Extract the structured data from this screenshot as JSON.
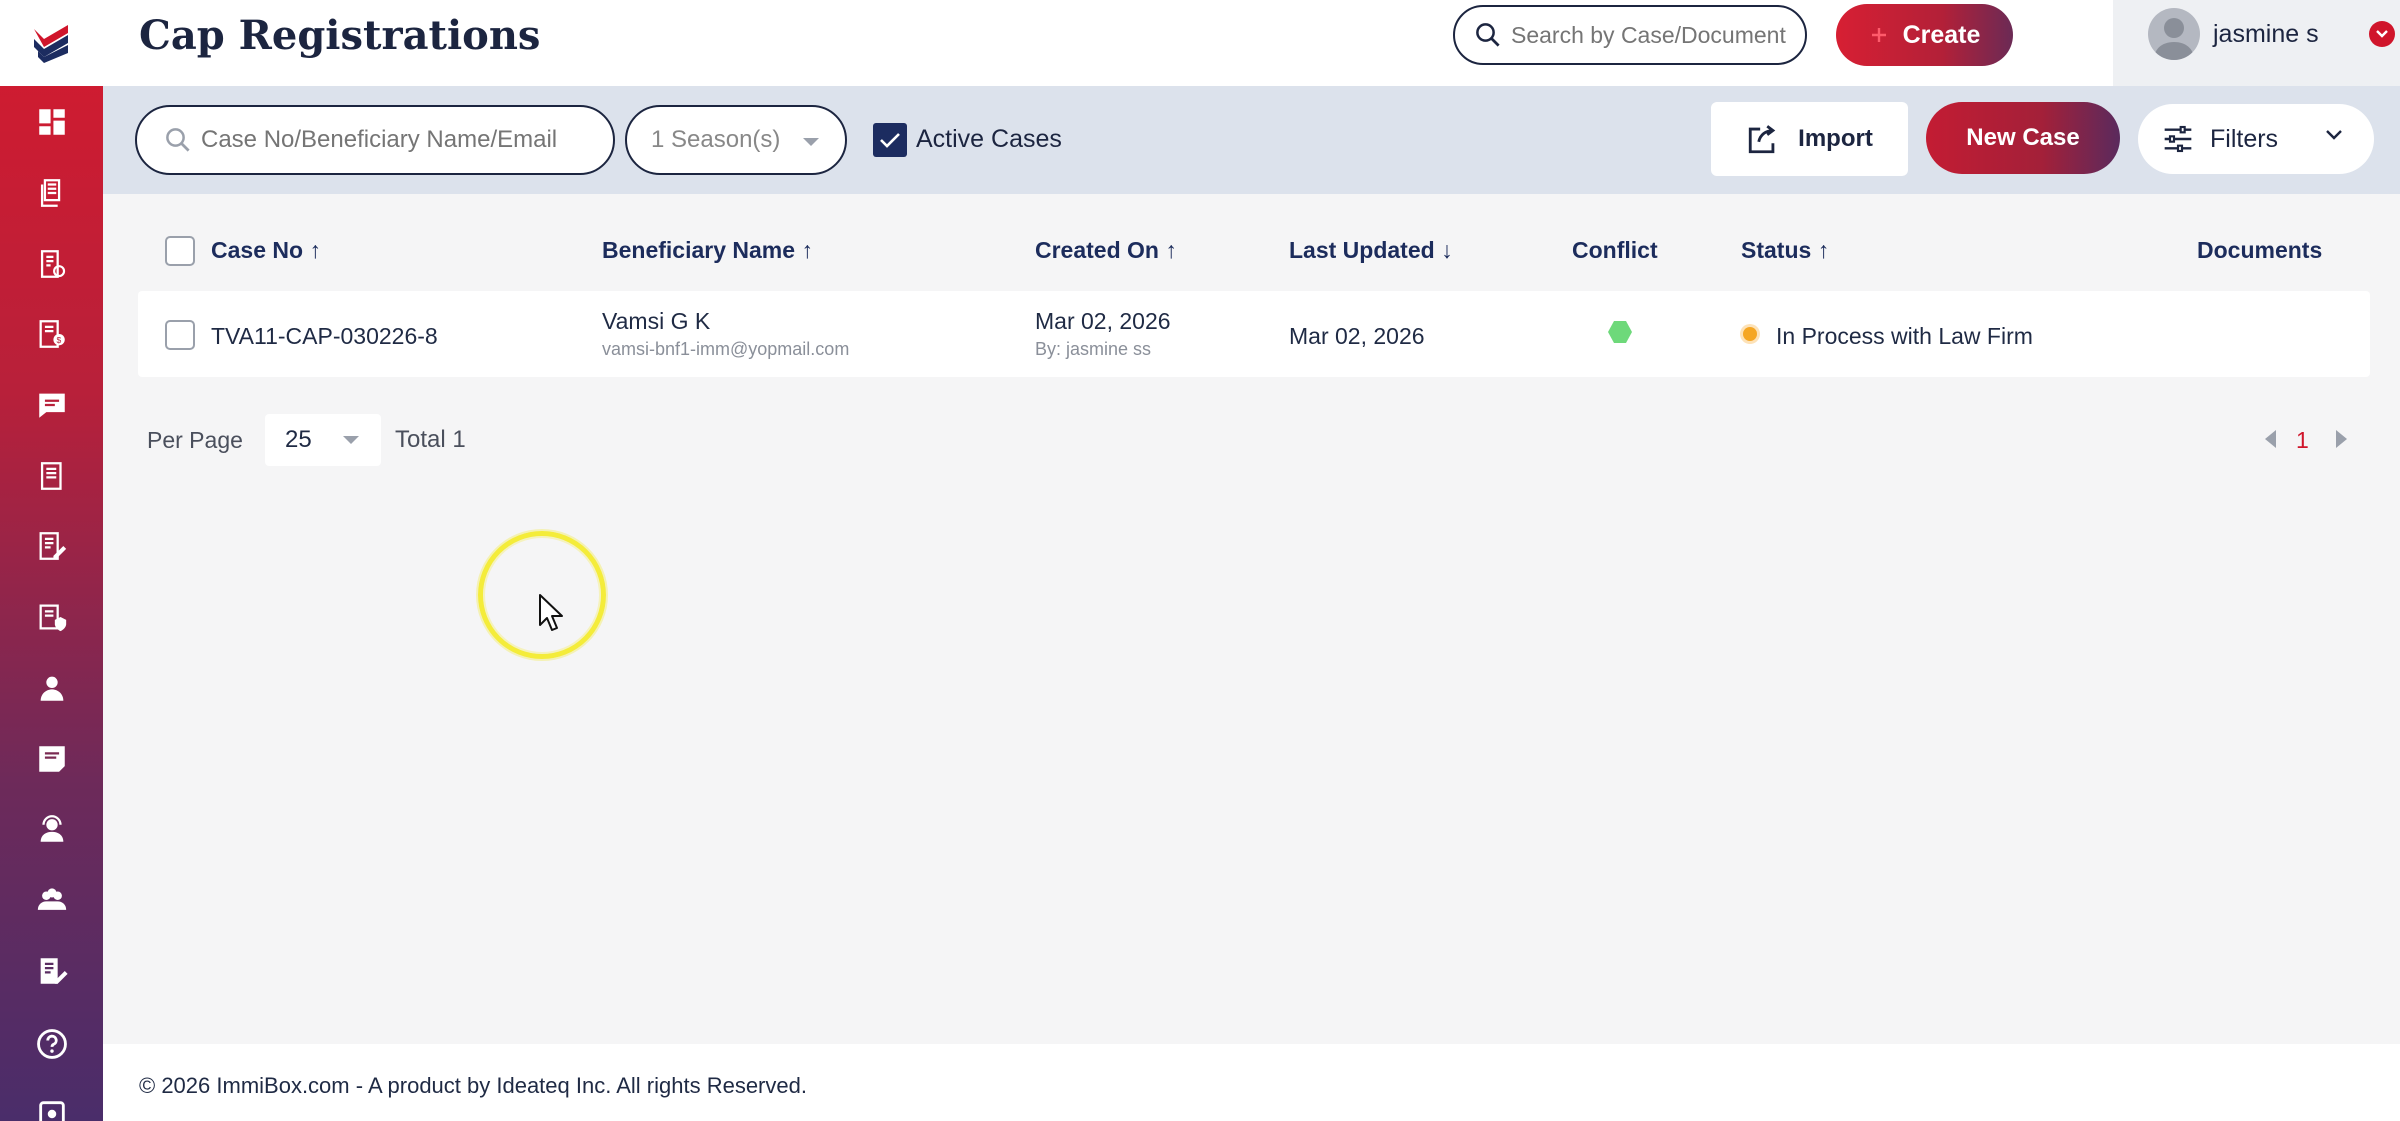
{
  "app": {
    "page_title": "Cap Registrations"
  },
  "sidebar": {
    "items": [
      {
        "icon": "dashboard-icon"
      },
      {
        "icon": "documents-icon"
      },
      {
        "icon": "forms-icon"
      },
      {
        "icon": "invoices-icon"
      },
      {
        "icon": "messages-icon"
      },
      {
        "icon": "book-icon"
      },
      {
        "icon": "edit-list-icon"
      },
      {
        "icon": "reports-icon"
      },
      {
        "icon": "person-icon"
      },
      {
        "icon": "notes-icon"
      },
      {
        "icon": "support-agent-icon"
      },
      {
        "icon": "team-icon"
      },
      {
        "icon": "document-edit-icon"
      },
      {
        "icon": "help-icon"
      },
      {
        "icon": "settings-icon"
      }
    ]
  },
  "header": {
    "search_placeholder": "Search by Case/Document",
    "create_label": "Create",
    "user_name": "jasmine s"
  },
  "toolbar": {
    "case_search_placeholder": "Case No/Beneficiary Name/Email",
    "season_value": "1 Season(s)",
    "active_cases_label": "Active Cases",
    "active_cases_checked": true,
    "import_label": "Import",
    "new_case_label": "New Case",
    "filters_label": "Filters"
  },
  "table": {
    "columns": {
      "case_no": "Case No",
      "beneficiary": "Beneficiary Name",
      "created_on": "Created On",
      "last_updated": "Last Updated",
      "conflict": "Conflict",
      "status": "Status",
      "documents": "Documents"
    },
    "sort_indicators": {
      "case_no": "↑",
      "beneficiary": "↑",
      "created_on": "↑",
      "last_updated": "↓",
      "status": "↑"
    },
    "rows": [
      {
        "case_no": "TVA11-CAP-030226-8",
        "beneficiary_name": "Vamsi G K",
        "beneficiary_email": "vamsi-bnf1-imm@yopmail.com",
        "created_on": "Mar 02, 2026",
        "created_by": "By: jasmine ss",
        "last_updated": "Mar 02, 2026",
        "conflict_color": "#6ed97a",
        "status": "In Process with Law Firm",
        "status_color": "#f5a623"
      }
    ]
  },
  "pagination": {
    "per_page_label": "Per Page",
    "per_page_value": "25",
    "total_label": "Total 1",
    "current_page": "1"
  },
  "footer": {
    "text": "© 2026 ImmiBox.com - A product by Ideateq Inc. All rights Reserved."
  },
  "colors": {
    "brand_red": "#d0152b",
    "navy": "#1c2540"
  }
}
